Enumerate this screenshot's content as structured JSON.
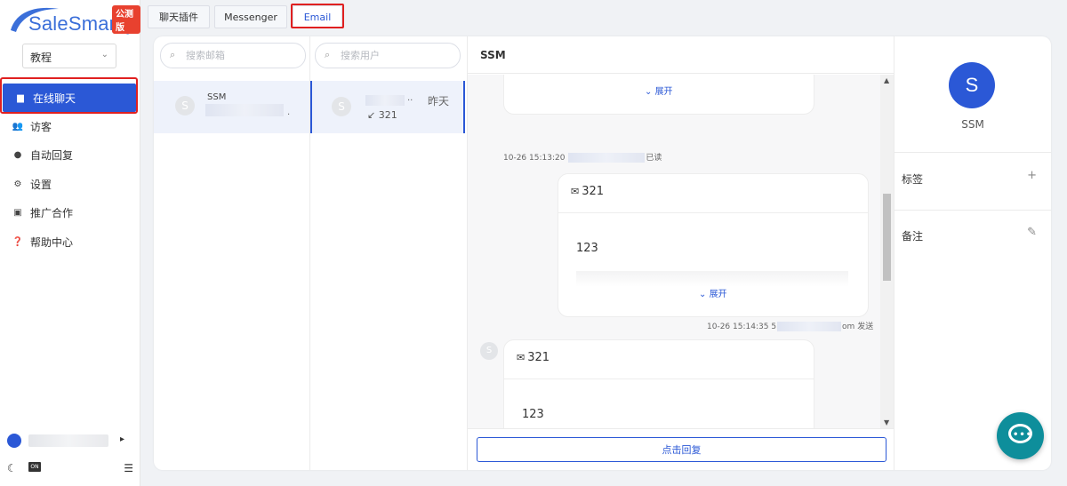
{
  "brand": {
    "logo_text": "SaleSmartly",
    "badge": "公测版"
  },
  "workspace": {
    "selected": "教程"
  },
  "nav": [
    {
      "label": "在线聊天",
      "icon": "chat-icon"
    },
    {
      "label": "访客",
      "icon": "visitors-icon"
    },
    {
      "label": "自动回复",
      "icon": "robot-icon"
    },
    {
      "label": "设置",
      "icon": "gear-icon"
    },
    {
      "label": "推广合作",
      "icon": "gift-icon"
    },
    {
      "label": "帮助中心",
      "icon": "help-icon"
    }
  ],
  "sidebar_bottom": {
    "user_arrow": "▸",
    "on_label": "ON"
  },
  "tabs": [
    {
      "label": "聊天插件"
    },
    {
      "label": "Messenger"
    },
    {
      "label": "Email"
    }
  ],
  "mailbox": {
    "search_placeholder": "搜索邮箱",
    "items": [
      {
        "initial": "S",
        "name": "SSM",
        "suffix": "."
      }
    ]
  },
  "users": {
    "search_placeholder": "搜索用户",
    "items": [
      {
        "initial": "S",
        "name_suffix": "..",
        "time": "昨天",
        "preview": "↙ 321"
      }
    ]
  },
  "chat": {
    "title": "SSM",
    "expand_label": "展开",
    "messages": [
      {
        "meta_time": "10-26 15:13:20",
        "meta_status": "已读"
      },
      {
        "subject": "321",
        "body": "123",
        "meta_time": "10-26 15:14:35",
        "meta_prefix": "5",
        "meta_suffix": "om",
        "meta_status": "发送"
      },
      {
        "subject": "321",
        "body": "123",
        "avatar": "S"
      }
    ],
    "reply_button": "点击回复"
  },
  "profile": {
    "initial": "S",
    "name": "SSM",
    "tags_label": "标签",
    "notes_label": "备注"
  },
  "colors": {
    "primary": "#2b58d6",
    "highlight": "#e02020",
    "fab": "#0e8e9b"
  }
}
